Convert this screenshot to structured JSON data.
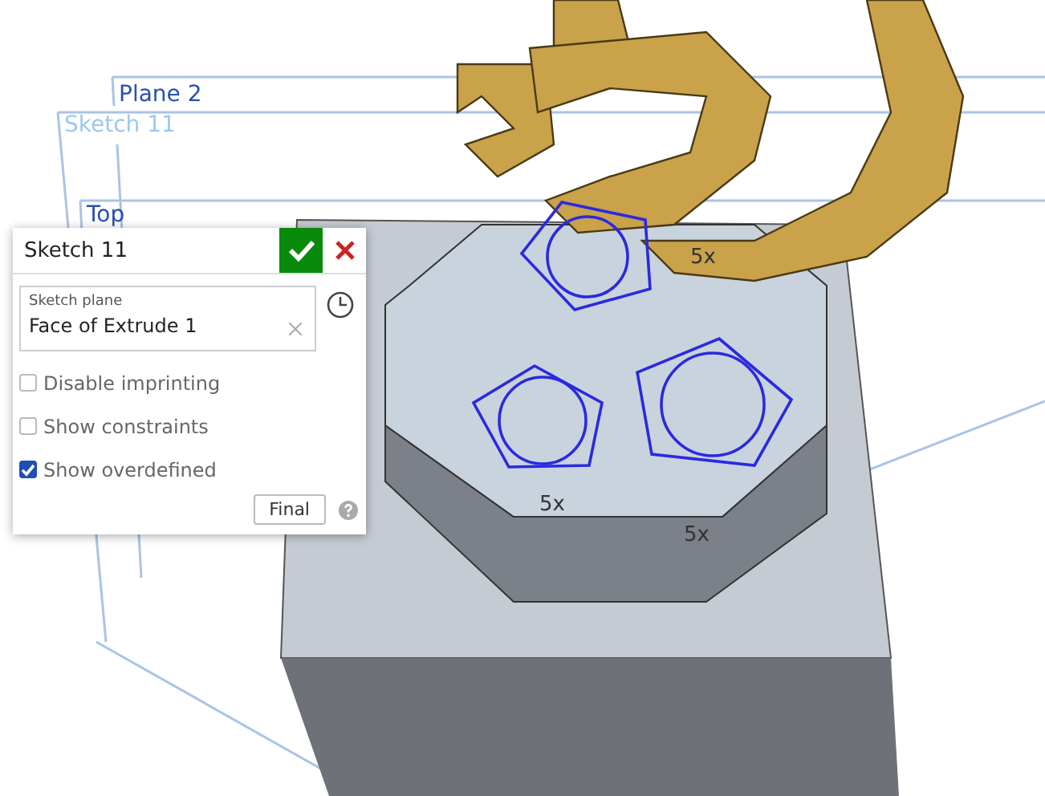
{
  "viewport": {
    "planes": [
      {
        "label": "Plane 2"
      },
      {
        "label": "Sketch 11"
      },
      {
        "label": "Top"
      }
    ],
    "dimension_labels": [
      "5x",
      "5x",
      "5x"
    ]
  },
  "sketch_panel": {
    "title": "Sketch 11",
    "sketch_plane": {
      "label": "Sketch plane",
      "value": "Face of Extrude 1"
    },
    "options": [
      {
        "label": "Disable imprinting",
        "checked": false
      },
      {
        "label": "Show constraints",
        "checked": false
      },
      {
        "label": "Show overdefined",
        "checked": true
      }
    ],
    "final_button": "Final"
  }
}
